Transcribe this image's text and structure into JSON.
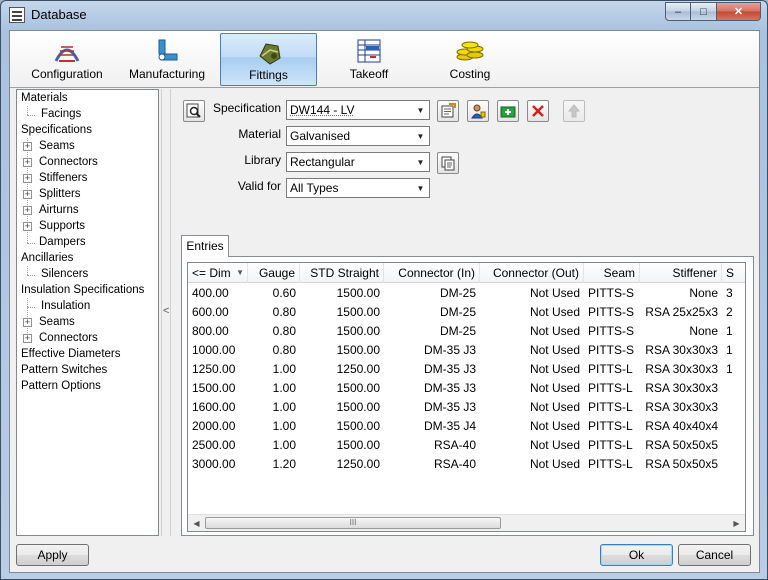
{
  "window": {
    "title": "Database",
    "caption": {
      "min": "–",
      "max": "□",
      "close": "✕"
    }
  },
  "toolbar": {
    "buttons": [
      {
        "label": "Configuration",
        "icon": "configuration-icon"
      },
      {
        "label": "Manufacturing",
        "icon": "manufacturing-icon"
      },
      {
        "label": "Fittings",
        "icon": "fittings-icon",
        "active": true
      },
      {
        "label": "Takeoff",
        "icon": "takeoff-icon"
      },
      {
        "label": "Costing",
        "icon": "costing-icon"
      }
    ]
  },
  "tree": {
    "items": [
      {
        "label": "Materials"
      },
      {
        "label": "Facings"
      },
      {
        "label": "Specifications"
      },
      {
        "label": "Seams"
      },
      {
        "label": "Connectors"
      },
      {
        "label": "Stiffeners"
      },
      {
        "label": "Splitters"
      },
      {
        "label": "Airturns"
      },
      {
        "label": "Supports"
      },
      {
        "label": "Dampers"
      },
      {
        "label": "Ancillaries"
      },
      {
        "label": "Silencers"
      },
      {
        "label": "Insulation Specifications"
      },
      {
        "label": "Insulation"
      },
      {
        "label": "Seams"
      },
      {
        "label": "Connectors"
      },
      {
        "label": "Effective Diameters"
      },
      {
        "label": "Pattern Switches"
      },
      {
        "label": "Pattern Options"
      }
    ],
    "expander_symbol": "+",
    "splitter_symbol": "<"
  },
  "form": {
    "specification": {
      "label": "Specification",
      "value": "DW144 - LV"
    },
    "material": {
      "label": "Material",
      "value": "Galvanised"
    },
    "library": {
      "label": "Library",
      "value": "Rectangular"
    },
    "valid_for": {
      "label": "Valid for",
      "value": "All Types"
    },
    "dropdown_arrow": "▼"
  },
  "tabs": {
    "entries": "Entries"
  },
  "table": {
    "columns": [
      "<= Dim",
      "Gauge",
      "STD Straight",
      "Connector (In)",
      "Connector (Out)",
      "Seam",
      "Stiffener",
      "S"
    ],
    "sort_indicator": "▼",
    "rows": [
      [
        "400.00",
        "0.60",
        "1500.00",
        "DM-25",
        "Not Used",
        "PITTS-S",
        "None",
        "3"
      ],
      [
        "600.00",
        "0.80",
        "1500.00",
        "DM-25",
        "Not Used",
        "PITTS-S",
        "RSA 25x25x3",
        "2"
      ],
      [
        "800.00",
        "0.80",
        "1500.00",
        "DM-25",
        "Not Used",
        "PITTS-S",
        "None",
        "1"
      ],
      [
        "1000.00",
        "0.80",
        "1500.00",
        "DM-35 J3",
        "Not Used",
        "PITTS-S",
        "RSA 30x30x3",
        "1"
      ],
      [
        "1250.00",
        "1.00",
        "1250.00",
        "DM-35 J3",
        "Not Used",
        "PITTS-L",
        "RSA 30x30x3",
        "1"
      ],
      [
        "1500.00",
        "1.00",
        "1500.00",
        "DM-35 J3",
        "Not Used",
        "PITTS-L",
        "RSA 30x30x3",
        ""
      ],
      [
        "1600.00",
        "1.00",
        "1500.00",
        "DM-35 J3",
        "Not Used",
        "PITTS-L",
        "RSA 30x30x3",
        ""
      ],
      [
        "2000.00",
        "1.00",
        "1500.00",
        "DM-35 J4",
        "Not Used",
        "PITTS-L",
        "RSA 40x40x4",
        ""
      ],
      [
        "2500.00",
        "1.00",
        "1500.00",
        "RSA-40",
        "Not Used",
        "PITTS-L",
        "RSA 50x50x5",
        ""
      ],
      [
        "3000.00",
        "1.20",
        "1250.00",
        "RSA-40",
        "Not Used",
        "PITTS-L",
        "RSA 50x50x5",
        ""
      ]
    ],
    "scroll": {
      "left": "◀",
      "right": "▶",
      "grip": "III"
    }
  },
  "footer": {
    "apply": "Apply",
    "ok": "Ok",
    "cancel": "Cancel"
  },
  "colors": {
    "accent": "#3c7fb1",
    "selection": "#c1dcf8"
  }
}
